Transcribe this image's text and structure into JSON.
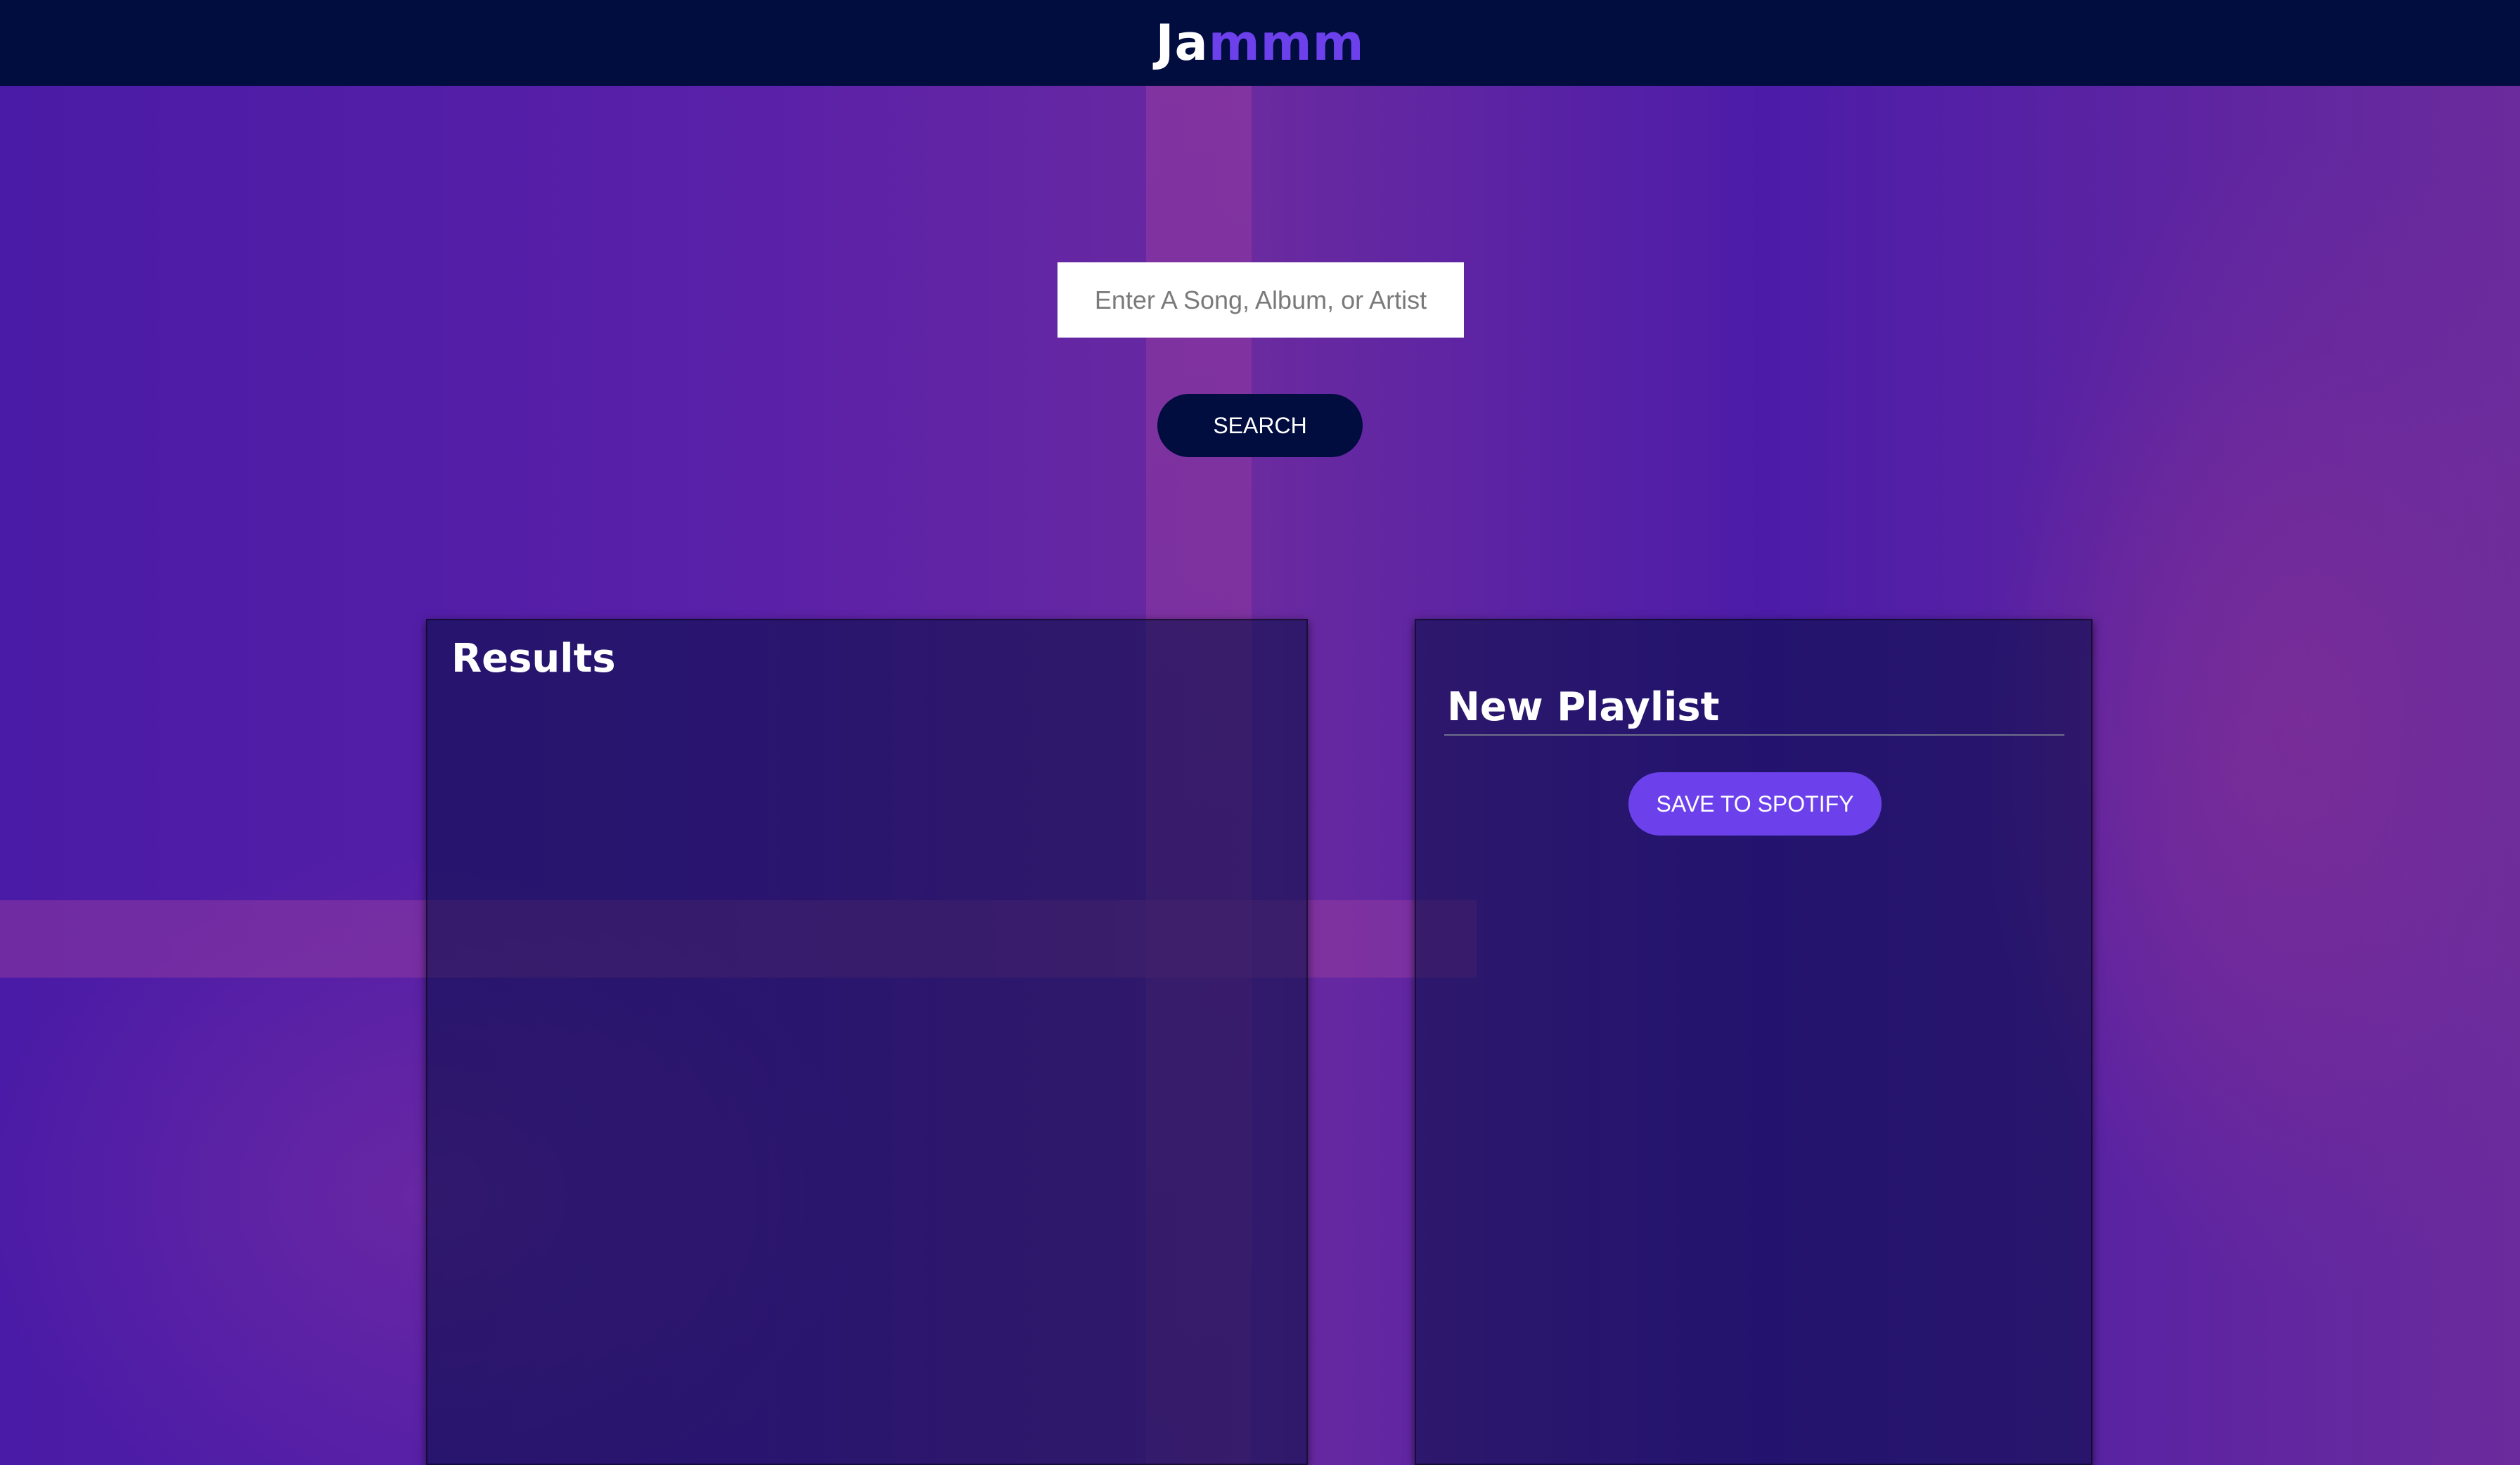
{
  "header": {
    "logo_part1": "Ja",
    "logo_part2": "mmm"
  },
  "search": {
    "placeholder": "Enter A Song, Album, or Artist",
    "value": "",
    "button_label": "SEARCH"
  },
  "results": {
    "title": "Results",
    "tracks": []
  },
  "playlist": {
    "name": "New Playlist",
    "save_label": "SAVE TO SPOTIFY",
    "tracks": []
  },
  "colors": {
    "header_bg": "#010c3f",
    "accent": "#6c41ec",
    "background": "#5a1fa8"
  }
}
